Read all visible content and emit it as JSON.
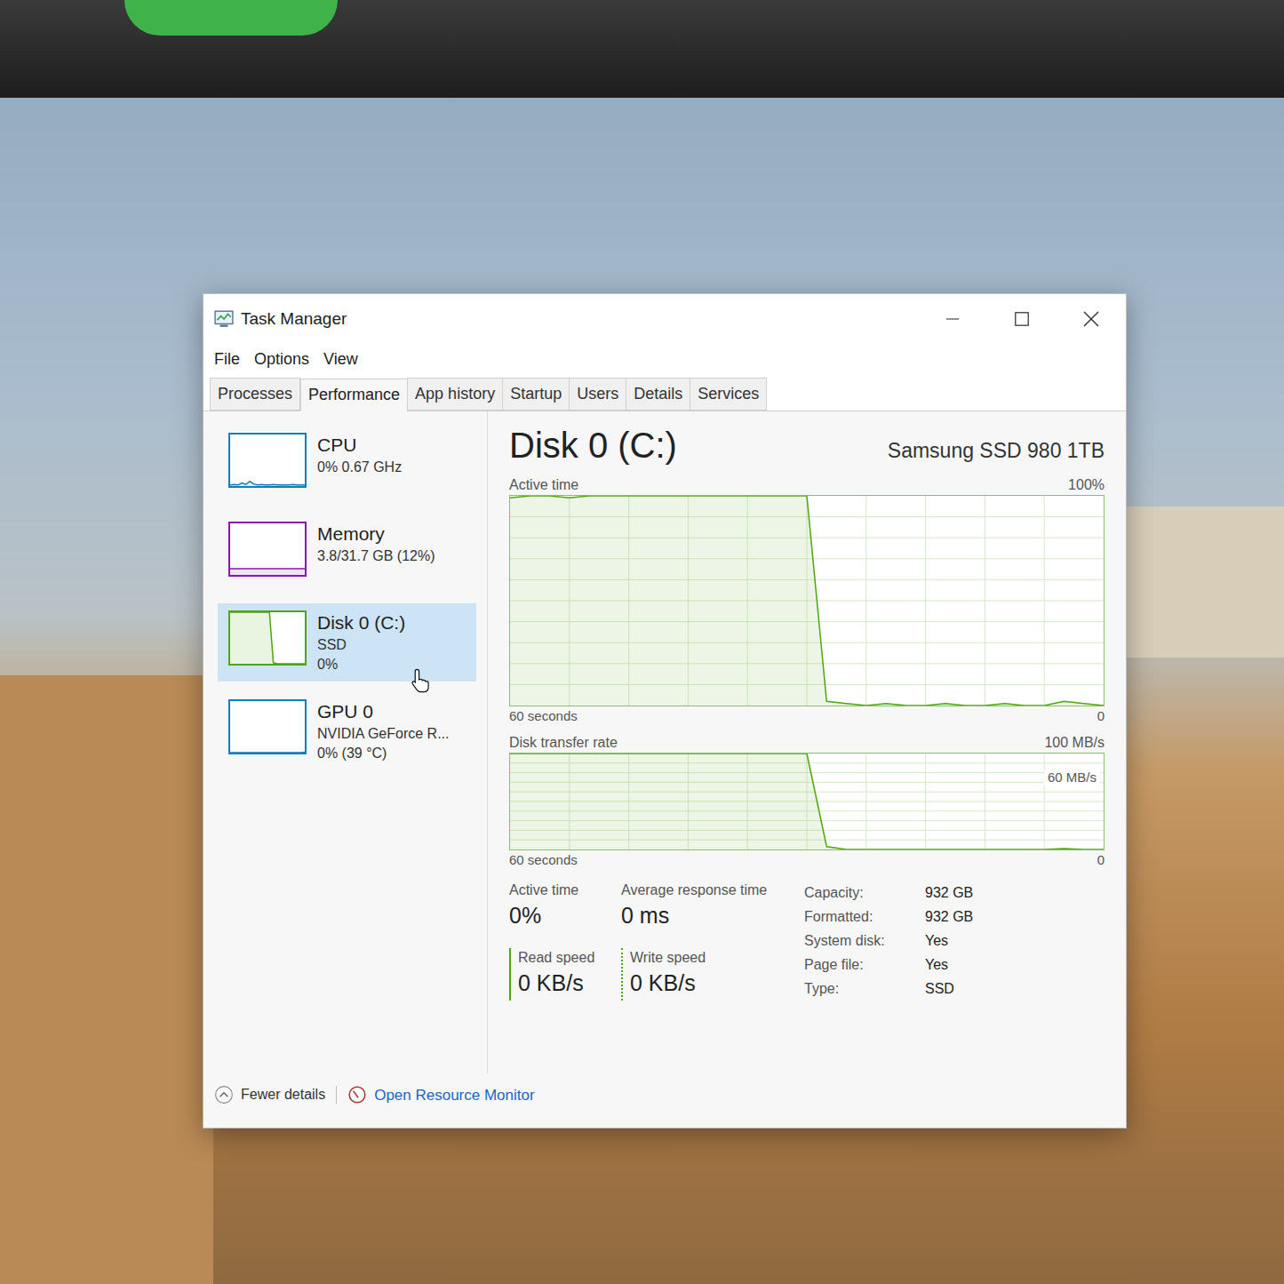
{
  "window": {
    "title": "Task Manager"
  },
  "menu": [
    "File",
    "Options",
    "View"
  ],
  "tabs": [
    {
      "label": "Processes",
      "selected": false
    },
    {
      "label": "Performance",
      "selected": true
    },
    {
      "label": "App history",
      "selected": false
    },
    {
      "label": "Startup",
      "selected": false
    },
    {
      "label": "Users",
      "selected": false
    },
    {
      "label": "Details",
      "selected": false
    },
    {
      "label": "Services",
      "selected": false
    }
  ],
  "sidebar": {
    "items": [
      {
        "name": "CPU",
        "lines": [
          "0% 0.67 GHz"
        ],
        "selected": false,
        "color": "#117dbb",
        "graph": [
          2,
          3,
          2,
          6,
          3,
          9,
          4,
          2,
          3,
          2,
          2,
          3,
          2,
          2,
          2,
          2,
          3,
          2,
          2,
          2
        ]
      },
      {
        "name": "Memory",
        "lines": [
          "3.8/31.7 GB (12%)"
        ],
        "selected": false,
        "color": "#8b12ae",
        "graph": [
          12,
          12,
          12,
          12,
          12,
          12,
          12,
          12,
          12,
          12,
          12,
          12,
          12,
          12,
          12,
          12,
          12,
          12,
          12,
          12
        ]
      },
      {
        "name": "Disk 0 (C:)",
        "lines": [
          "SSD",
          "0%"
        ],
        "selected": true,
        "color": "#4da60c",
        "graph": [
          100,
          100,
          100,
          100,
          100,
          100,
          100,
          100,
          100,
          100,
          100,
          2,
          0,
          0,
          0,
          0,
          0,
          0,
          0,
          0
        ]
      },
      {
        "name": "GPU 0",
        "lines": [
          "NVIDIA GeForce R...",
          "0% (39 °C)"
        ],
        "selected": false,
        "color": "#117dbb",
        "graph": [
          0,
          0,
          0,
          0,
          0,
          0,
          0,
          0,
          0,
          0,
          0,
          0,
          0,
          0,
          0,
          0,
          0,
          0,
          0,
          1
        ]
      }
    ]
  },
  "detail": {
    "title": "Disk 0 (C:)",
    "model": "Samsung SSD 980 1TB",
    "charts": [
      {
        "label": "Active time",
        "max_label": "100%",
        "max": 100,
        "time_label": "60 seconds",
        "min_label": "0",
        "values": [
          99,
          100,
          100,
          99,
          100,
          100,
          100,
          100,
          100,
          100,
          100,
          100,
          100,
          100,
          100,
          100,
          2,
          1,
          0,
          1,
          0,
          0,
          1,
          0,
          0,
          1,
          0,
          0,
          2,
          1,
          0
        ]
      },
      {
        "label": "Disk transfer rate",
        "max_label": "100 MB/s",
        "max": 100,
        "time_label": "60 seconds",
        "min_label": "0",
        "marker": 60,
        "marker_label": "60 MB/s",
        "values": [
          100,
          100,
          100,
          100,
          100,
          100,
          100,
          100,
          100,
          100,
          100,
          100,
          100,
          100,
          100,
          100,
          3,
          0,
          0,
          0,
          0,
          0,
          0,
          0,
          0,
          0,
          0,
          0,
          1,
          0,
          0
        ]
      }
    ],
    "stats": [
      {
        "label": "Active time",
        "value": "0%",
        "kind": "plain"
      },
      {
        "label": "Average response time",
        "value": "0 ms",
        "kind": "plain"
      },
      {
        "label": "Read speed",
        "value": "0 KB/s",
        "kind": "read"
      },
      {
        "label": "Write speed",
        "value": "0 KB/s",
        "kind": "write"
      }
    ],
    "properties": [
      {
        "label": "Capacity:",
        "value": "932 GB"
      },
      {
        "label": "Formatted:",
        "value": "932 GB"
      },
      {
        "label": "System disk:",
        "value": "Yes"
      },
      {
        "label": "Page file:",
        "value": "Yes"
      },
      {
        "label": "Type:",
        "value": "SSD"
      }
    ]
  },
  "footer": {
    "fewer_details": "Fewer details",
    "resource_monitor": "Open Resource Monitor"
  }
}
